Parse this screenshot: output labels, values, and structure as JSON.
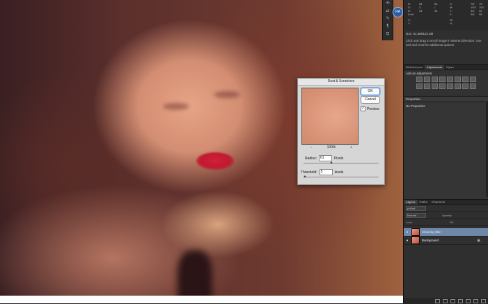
{
  "dialog": {
    "title": "Dust & Scratches",
    "ok_label": "OK",
    "cancel_label": "Cancel",
    "preview_label": "Preview",
    "preview_checked": "✓",
    "zoom_out_icon": "−",
    "zoom_in_icon": "+",
    "zoom_level": "100%",
    "radius_label": "Radius:",
    "radius_value": "61",
    "radius_unit": "Pixels",
    "threshold_label": "Threshold:",
    "threshold_value": "5",
    "threshold_unit": "levels"
  },
  "toolstrip": {
    "icons": [
      "reset-icon",
      "arrows-icon",
      "brush-icon",
      "paragraph-icon",
      "layers-icon"
    ],
    "glyphs": [
      "⟲",
      "⇄",
      "✎",
      "¶",
      "⊡"
    ]
  },
  "avatar": {
    "label": "RA"
  },
  "info": {
    "col1": [
      "R:",
      "G:",
      "B:",
      "8-bit"
    ],
    "col2": [
      "54",
      "3",
      "44",
      "8-bit"
    ],
    "col3": [
      "54",
      "/",
      "44",
      ""
    ],
    "col4": [
      "C:",
      "M:",
      "Y:",
      "K:"
    ],
    "col5": [
      "75/",
      "100/",
      "42/",
      "98/"
    ],
    "col6": [
      "75",
      "100",
      "42",
      "98"
    ],
    "xy": [
      "X:",
      "Y:"
    ],
    "wh": [
      "W:",
      "H:"
    ],
    "doc": "Doc: 61.3M/122.3M",
    "hint": "Click and drag to scroll image in desired direction.  Use Ctrl and Cmd for additional options"
  },
  "adjustments": {
    "tabs": [
      "Bibliothèques",
      "Adjustments",
      "Styles"
    ],
    "active_tab": "Adjustments",
    "add_label": "Add an adjustment"
  },
  "properties": {
    "title": "Properties",
    "empty_label": "No Properties"
  },
  "layers": {
    "tabs": [
      "Layers",
      "Paths",
      "Channels"
    ],
    "kind_label": "ρ Kind",
    "blend_mode": "Normal",
    "opacity_label": "Opacity:",
    "lock_label": "Lock:",
    "fill_label": "Fill:",
    "items": [
      {
        "name": "Cleaning Skin",
        "visible": "👁",
        "active": true
      },
      {
        "name": "Background",
        "visible": "👁",
        "active": false
      }
    ],
    "lock_icon": "🔒"
  },
  "colors": {
    "accent": "#6f88a8",
    "lips": "#c0192f",
    "dialog_bg": "#d6d6d6"
  }
}
